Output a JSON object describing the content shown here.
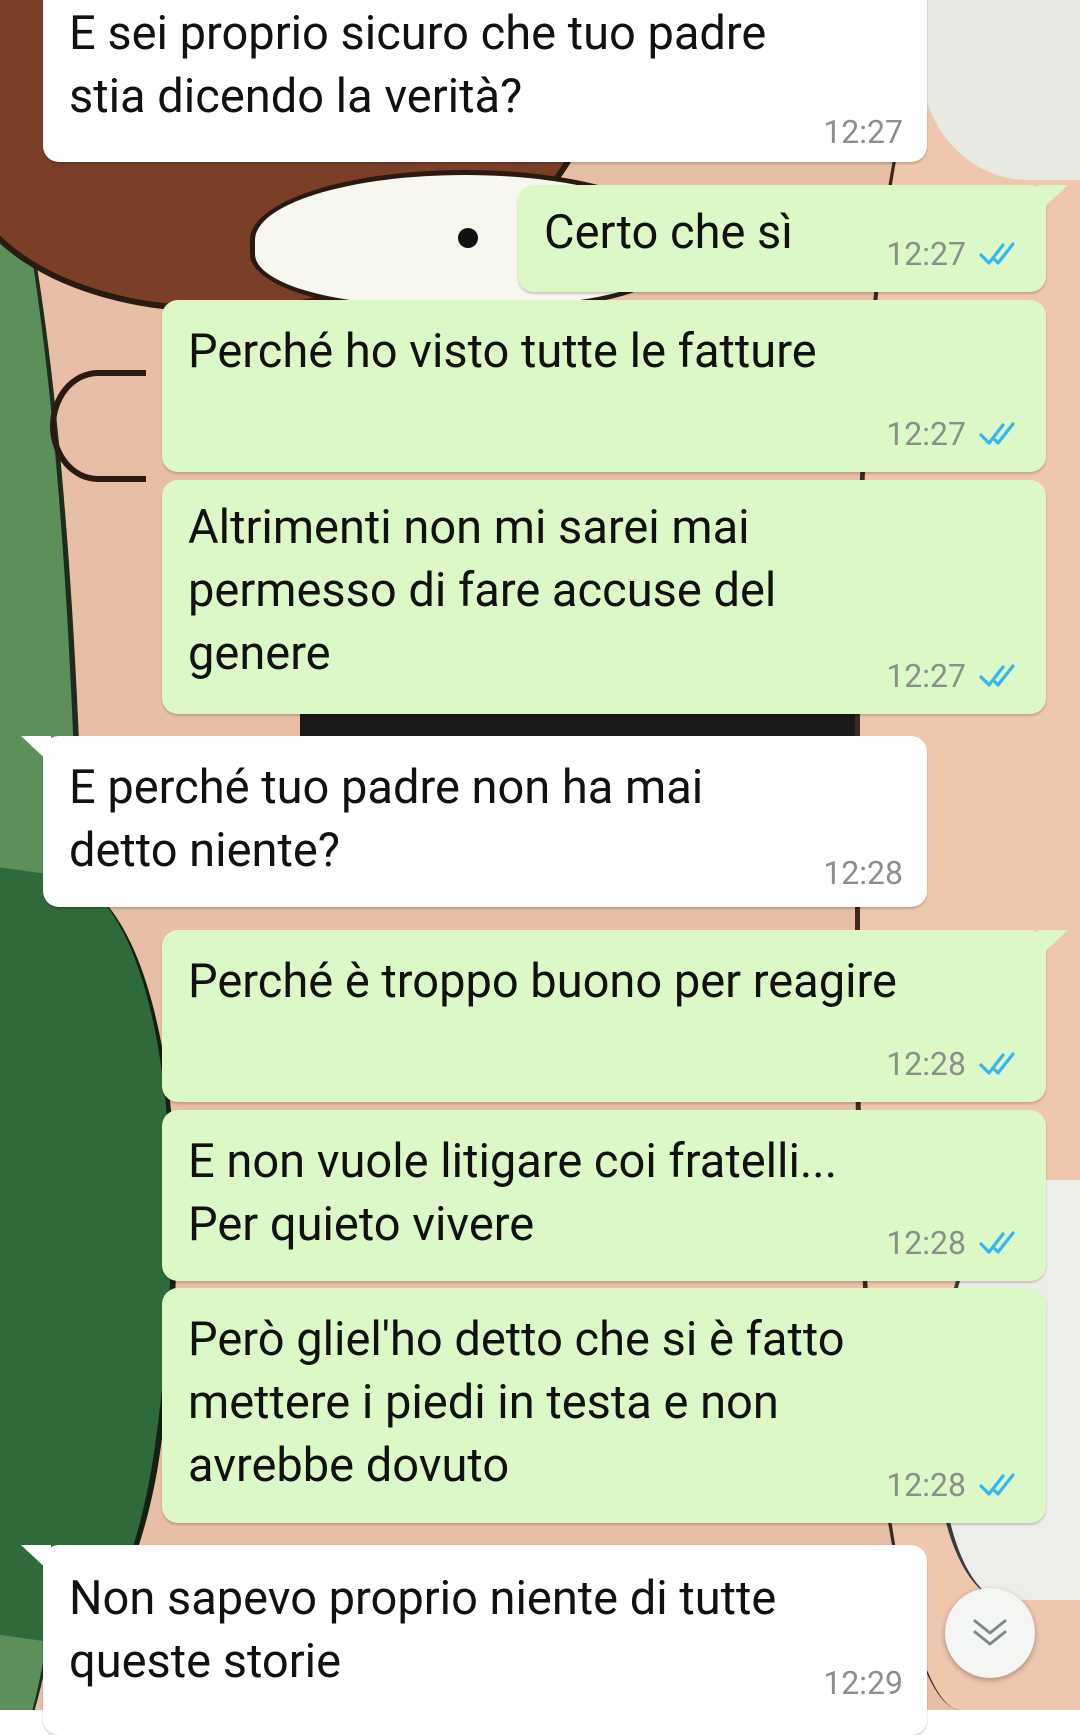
{
  "messages": [
    {
      "direction": "in",
      "text": "E sei proprio sicuro che tuo padre\nstia dicendo la verità?",
      "time": "12:27"
    },
    {
      "direction": "out",
      "text": "Certo che sì",
      "time": "12:27",
      "status": "read"
    },
    {
      "direction": "out",
      "text": "Perché ho visto tutte le fatture",
      "time": "12:27",
      "status": "read"
    },
    {
      "direction": "out",
      "text": "Altrimenti non mi sarei mai\npermesso di fare accuse del\ngenere",
      "time": "12:27",
      "status": "read"
    },
    {
      "direction": "in",
      "text": "E perché tuo padre non ha mai\ndetto niente?",
      "time": "12:28"
    },
    {
      "direction": "out",
      "text": "Perché è troppo buono per reagire",
      "time": "12:28",
      "status": "read"
    },
    {
      "direction": "out",
      "text": "E non vuole litigare coi fratelli...\nPer quieto vivere",
      "time": "12:28",
      "status": "read"
    },
    {
      "direction": "out",
      "text": "Però gliel'ho detto che si è fatto\nmettere i piedi in testa e non\navrebbe dovuto",
      "time": "12:28",
      "status": "read"
    },
    {
      "direction": "in",
      "text": "Non sapevo proprio niente di tutte\nqueste storie",
      "time": "12:29"
    }
  ],
  "icons": {
    "read_receipt": "double-check-icon",
    "scroll_down": "double-chevron-down-icon"
  },
  "colors": {
    "incoming_bubble": "#ffffff",
    "outgoing_bubble": "#dcf8c6",
    "read_tick": "#34b7f1",
    "timestamp": "#8a8f8a"
  }
}
